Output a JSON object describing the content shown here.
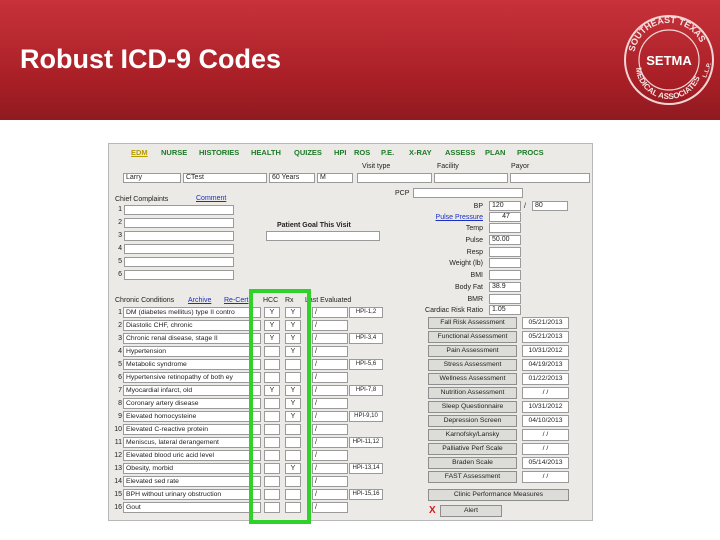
{
  "slide": {
    "title": "Robust ICD-9 Codes"
  },
  "logo": {
    "ring_text_top": "SOUTHEAST TEXAS",
    "ring_text_bottom": "MEDICAL ASSOCIATES",
    "suffix": "L.L.P.",
    "mark": "SETMA"
  },
  "nav": [
    "EDM",
    "NURSE",
    "HISTORIES",
    "HEALTH",
    "QUIZES",
    "HPI",
    "ROS",
    "P.E.",
    "X-RAY",
    "ASSESS",
    "PLAN",
    "PROCS"
  ],
  "visit": {
    "visit_type_label": "Visit type",
    "facility_label": "Facility",
    "payor_label": "Payor",
    "first_name": "Larry",
    "last_name": "CTest",
    "age": "60 Years",
    "sex": "M",
    "pcp_label": "PCP"
  },
  "complaints": {
    "label": "Chief Complaints",
    "comment_label": "Comment",
    "numbers": [
      "1",
      "2",
      "3",
      "4",
      "5",
      "6"
    ],
    "goal_label": "Patient Goal This Visit"
  },
  "vitals": {
    "labels": [
      "BP",
      "Pulse Pressure",
      "Temp",
      "Pulse",
      "Resp",
      "Weight (lb)",
      "BMI",
      "Body Fat",
      "BMR",
      "Cardiac Risk Ratio"
    ],
    "bp_sys": "120",
    "bp_dia": "80",
    "pulse_pressure": "47",
    "pulse": "50.00",
    "body_fat": "38.9",
    "cardiac_risk_ratio": "1.05"
  },
  "conditions": {
    "header": "Chronic Conditions",
    "archive": "Archive",
    "recent": "Re-Cert",
    "hcc": "HCC",
    "rx": "Rx",
    "last_eval": "Last Evaluated",
    "rows": [
      {
        "n": "1",
        "name": "DM (diabetes mellitus) type II contro",
        "hcc": "Y",
        "rx": "Y",
        "last": "/",
        "hpi": "HPI-1,2"
      },
      {
        "n": "2",
        "name": "Diastolic CHF, chronic",
        "hcc": "Y",
        "rx": "Y",
        "last": "/",
        "hpi": ""
      },
      {
        "n": "3",
        "name": "Chronic renal disease, stage II",
        "hcc": "Y",
        "rx": "Y",
        "last": "/",
        "hpi": "HPI-3,4"
      },
      {
        "n": "4",
        "name": "Hypertension",
        "hcc": "",
        "rx": "Y",
        "last": "/",
        "hpi": ""
      },
      {
        "n": "5",
        "name": "Metabolic syndrome",
        "hcc": "",
        "rx": "",
        "last": "/",
        "hpi": "HPI-5,6"
      },
      {
        "n": "6",
        "name": "Hypertensive retinopathy of both ey",
        "hcc": "",
        "rx": "",
        "last": "/",
        "hpi": ""
      },
      {
        "n": "7",
        "name": "Myocardial infarct, old",
        "hcc": "Y",
        "rx": "Y",
        "last": "/",
        "hpi": "HPI-7,8"
      },
      {
        "n": "8",
        "name": "Coronary artery disease",
        "hcc": "",
        "rx": "Y",
        "last": "/",
        "hpi": ""
      },
      {
        "n": "9",
        "name": "Elevated homocysteine",
        "hcc": "",
        "rx": "Y",
        "last": "/",
        "hpi": "HPI-9,10"
      },
      {
        "n": "10",
        "name": "Elevated C-reactive protein",
        "hcc": "",
        "rx": "",
        "last": "/",
        "hpi": ""
      },
      {
        "n": "11",
        "name": "Meniscus, lateral derangement",
        "hcc": "",
        "rx": "",
        "last": "/",
        "hpi": "HPI-11,12"
      },
      {
        "n": "12",
        "name": "Elevated blood uric acid level",
        "hcc": "",
        "rx": "",
        "last": "/",
        "hpi": ""
      },
      {
        "n": "13",
        "name": "Obesity, morbid",
        "hcc": "",
        "rx": "Y",
        "last": "/",
        "hpi": "HPI-13,14"
      },
      {
        "n": "14",
        "name": "Elevated sed rate",
        "hcc": "",
        "rx": "",
        "last": "/",
        "hpi": ""
      },
      {
        "n": "15",
        "name": "BPH without urinary obstruction",
        "hcc": "",
        "rx": "",
        "last": "/",
        "hpi": "HPI-15,16"
      },
      {
        "n": "16",
        "name": "Gout",
        "hcc": "",
        "rx": "",
        "last": "/",
        "hpi": ""
      }
    ]
  },
  "assessments": [
    {
      "label": "Fall Risk Assessment",
      "date": "05/21/2013"
    },
    {
      "label": "Functional Assessment",
      "date": "05/21/2013"
    },
    {
      "label": "Pain Assessment",
      "date": "10/31/2012"
    },
    {
      "label": "Stress Assessment",
      "date": "04/19/2013"
    },
    {
      "label": "Wellness Assessment",
      "date": "01/22/2013"
    },
    {
      "label": "Nutrition Assessment",
      "date": "/ /"
    },
    {
      "label": "Sleep Questionnaire",
      "date": "10/31/2012"
    },
    {
      "label": "Depression Screen",
      "date": "04/10/2013"
    },
    {
      "label": "Karnofsky/Lansky",
      "date": "/ /"
    },
    {
      "label": "Palliative Perf Scale",
      "date": "/ /"
    },
    {
      "label": "Braden Scale",
      "date": "05/14/2013"
    },
    {
      "label": "FAST Assessment",
      "date": "/ /"
    }
  ],
  "clinic_button": "Clinic Performance Measures",
  "alert": {
    "x": "X",
    "label": "Alert"
  },
  "colors": {
    "header_red": "#b3262c",
    "nav_green": "#1c7a27",
    "highlight_green": "#31d12b",
    "link_blue": "#1a2fc2"
  }
}
